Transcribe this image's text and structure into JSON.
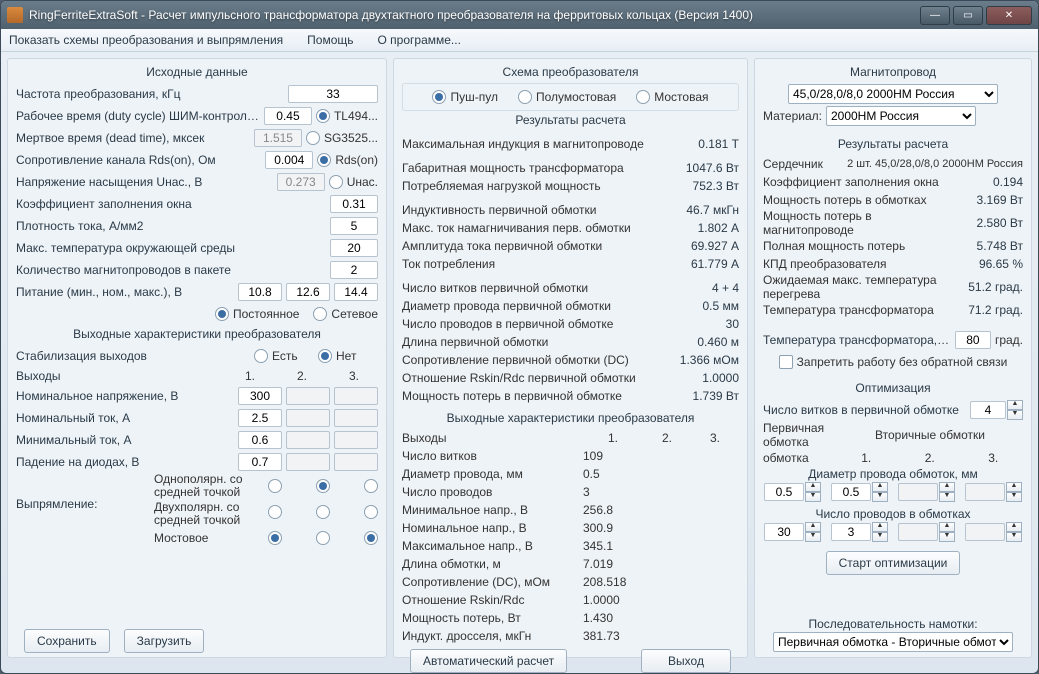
{
  "window": {
    "title": "RingFerriteExtraSoft - Расчет импульсного трансформатора двухтактного преобразователя на ферритовых кольцах (Версия 1400)"
  },
  "menu": {
    "m1": "Показать схемы преобразования и выпрямления",
    "m2": "Помощь",
    "m3": "О программе..."
  },
  "col1": {
    "title": "Исходные данные",
    "freq_lbl": "Частота преобразования, кГц",
    "freq": "33",
    "duty_lbl": "Рабочее время (duty cycle) ШИМ-контроллера",
    "duty": "0.45",
    "duty_radio": "TL494...",
    "dead_lbl": "Мертвое время (dead time), мксек",
    "dead": "1.515",
    "dead_radio": "SG3525...",
    "rds_lbl": "Сопротивление канала Rds(on), Ом",
    "rds": "0.004",
    "rds_radio": "Rds(on)",
    "usat_lbl": "Напряжение насыщения Uнас., В",
    "usat": "0.273",
    "usat_radio": "Uнас.",
    "fill_lbl": "Коэффициент заполнения окна",
    "fill": "0.31",
    "dens_lbl": "Плотность тока, А/мм2",
    "dens": "5",
    "temp_lbl": "Макс. температура окружающей среды",
    "temp": "20",
    "cores_lbl": "Количество магнитопроводов в пакете",
    "cores": "2",
    "pow_lbl": "Питание (мин., ном., макс.), В",
    "pmin": "10.8",
    "pnom": "12.6",
    "pmax": "14.4",
    "dc_radio": "Постоянное",
    "ac_radio": "Сетевое",
    "out_title": "Выходные характеристики преобразователя",
    "stab_lbl": "Стабилизация выходов",
    "stab_yes": "Есть",
    "stab_no": "Нет",
    "outputs_lbl": "Выходы",
    "c1": "1.",
    "c2": "2.",
    "c3": "3.",
    "vnom_lbl": "Номинальное напряжение, В",
    "vnom1": "300",
    "inom_lbl": "Номинальный ток, А",
    "inom1": "2.5",
    "imin_lbl": "Минимальный ток, А",
    "imin1": "0.6",
    "vd_lbl": "Падение на диодах, В",
    "vd1": "0.7",
    "rect_lbl": "Выпрямление:",
    "r1": "Однополярн. со средней точкой",
    "r2": "Двухполярн. со средней точкой",
    "r3": "Мостовое",
    "btn_save": "Сохранить",
    "btn_load": "Загрузить"
  },
  "col2": {
    "scheme_title": "Схема преобразователя",
    "s1": "Пуш-пул",
    "s2": "Полумостовая",
    "s3": "Мостовая",
    "res_title": "Результаты расчета",
    "l_bmax": "Максимальная индукция в магнитопроводе",
    "v_bmax": "0.181 Т",
    "l_pgab": "Габаритная мощность трансформатора",
    "v_pgab": "1047.6 Вт",
    "l_pload": "Потребляемая нагрузкой мощность",
    "v_pload": "752.3 Вт",
    "l_l1": "Индуктивность первичной обмотки",
    "v_l1": "46.7 мкГн",
    "l_imag": "Макс. ток намагничивания перв. обмотки",
    "v_imag": "1.802 А",
    "l_iamp": "Амплитуда тока первичной обмотки",
    "v_iamp": "69.927 А",
    "l_icon": "Ток потребления",
    "v_icon": "61.779 А",
    "l_n1": "Число витков первичной обмотки",
    "v_n1": "4 + 4",
    "l_d1": "Диаметр провода первичной обмотки",
    "v_d1": "0.5 мм",
    "l_np1": "Число проводов в первичной обмотке",
    "v_np1": "30",
    "l_len1": "Длина первичной обмотки",
    "v_len1": "0.460 м",
    "l_rdc1": "Сопротивление первичной обмотки (DC)",
    "v_rdc1": "1.366 мОм",
    "l_rsk1": "Отношение Rskin/Rdc первичной обмотки",
    "v_rsk1": "1.0000",
    "l_pl1": "Мощность потерь в первичной обмотке",
    "v_pl1": "1.739 Вт",
    "out_title": "Выходные характеристики преобразователя",
    "o_out": "Выходы",
    "o1": "1.",
    "o2": "2.",
    "o3": "3.",
    "o_n": "Число витков",
    "o_n1": "109",
    "o_d": "Диаметр провода, мм",
    "o_d1": "0.5",
    "o_np": "Число проводов",
    "o_np1": "3",
    "o_vmin": "Минимальное напр., В",
    "o_vmin1": "256.8",
    "o_vnom": "Номинальное напр., В",
    "o_vnom1": "300.9",
    "o_vmax": "Максимальное напр., В",
    "o_vmax1": "345.1",
    "o_len": "Длина обмотки, м",
    "o_len1": "7.019",
    "o_rdc": "Сопротивление (DC), мОм",
    "o_rdc1": "208.518",
    "o_rsk": "Отношение Rskin/Rdc",
    "o_rsk1": "1.0000",
    "o_pl": "Мощность потерь, Вт",
    "o_pl1": "1.430",
    "o_ind": "Индукт. дросселя, мкГн",
    "o_ind1": "381.73",
    "btn_auto": "Автоматический расчет",
    "btn_exit": "Выход"
  },
  "col3": {
    "core_title": "Магнитопровод",
    "core_sel": "45,0/28,0/8,0 2000НМ Россия",
    "mat_lbl": "Материал:",
    "mat_sel": "2000НМ Россия",
    "res_title": "Результаты расчета",
    "l_core": "Сердечник",
    "v_core": "2 шт. 45,0/28,0/8,0 2000НМ Россия",
    "l_fill": "Коэффициент заполнения окна",
    "v_fill": "0.194",
    "l_pw": "Мощность потерь в обмотках",
    "v_pw": "3.169 Вт",
    "l_pc": "Мощность потерь в магнитопроводе",
    "v_pc": "2.580 Вт",
    "l_pt": "Полная мощность потерь",
    "v_pt": "5.748 Вт",
    "l_eff": "КПД преобразователя",
    "v_eff": "96.65 %",
    "l_tmax": "Ожидаемая макс. температура перегрева",
    "v_tmax": "51.2 град.",
    "l_ttr": "Температура трансформатора",
    "v_ttr": "71.2 град.",
    "t_lim_lbl": "Температура трансформатора, не более",
    "t_lim": "80",
    "t_unit": "град.",
    "chk_fb": "Запретить работу без обратной связи",
    "opt_title": "Оптимизация",
    "opt_n1_lbl": "Число витков в первичной обмотке",
    "opt_n1": "4",
    "opt_w_lbl": "Первичная обмотка",
    "opt_w2": "Вторичные обмотки",
    "c1": "1.",
    "c2": "2.",
    "c3": "3.",
    "opt_d_lbl": "Диаметр провода обмоток, мм",
    "opt_d0": "0.5",
    "opt_d1": "0.5",
    "opt_np_lbl": "Число проводов в обмотках",
    "opt_np0": "30",
    "opt_np1": "3",
    "btn_opt": "Старт оптимизации",
    "seq_lbl": "Последовательность намотки:",
    "seq_sel": "Первичная обмотка - Вторичные обмотки"
  }
}
